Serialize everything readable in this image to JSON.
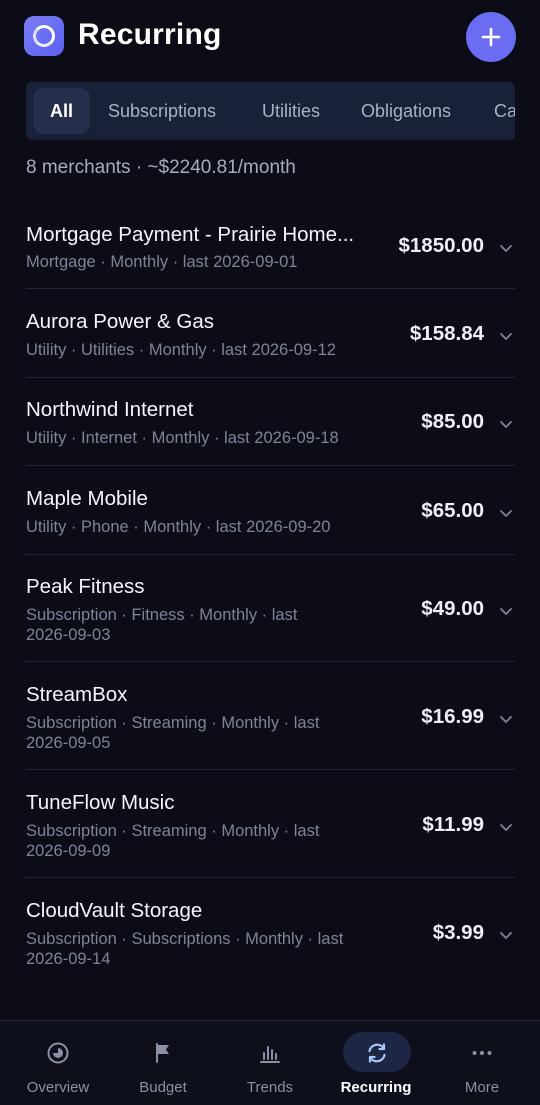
{
  "header": {
    "title": "Recurring",
    "logo_icon": "app-ring-logo-icon",
    "add_icon": "plus-icon"
  },
  "tabs": [
    {
      "label": "All",
      "active": true
    },
    {
      "label": "Subscriptions",
      "active": false
    },
    {
      "label": "Utilities",
      "active": false
    },
    {
      "label": "Obligations",
      "active": false
    },
    {
      "label": "Ca",
      "active": false
    }
  ],
  "summary": "8 merchants · ~$2240.81/month",
  "merchants": [
    {
      "name": "Mortgage Payment - Prairie Home...",
      "meta": "Mortgage · Monthly · last 2026-09-01",
      "amount": "$1850.00"
    },
    {
      "name": "Aurora Power & Gas",
      "meta": "Utility · Utilities · Monthly · last 2026-09-12",
      "amount": "$158.84"
    },
    {
      "name": "Northwind Internet",
      "meta": "Utility · Internet · Monthly · last 2026-09-18",
      "amount": "$85.00"
    },
    {
      "name": "Maple Mobile",
      "meta": "Utility · Phone · Monthly · last 2026-09-20",
      "amount": "$65.00"
    },
    {
      "name": "Peak Fitness",
      "meta": "Subscription · Fitness · Monthly · last 2026-09-03",
      "amount": "$49.00"
    },
    {
      "name": "StreamBox",
      "meta": "Subscription · Streaming · Monthly · last 2026-09-05",
      "amount": "$16.99"
    },
    {
      "name": "TuneFlow Music",
      "meta": "Subscription · Streaming · Monthly · last 2026-09-09",
      "amount": "$11.99"
    },
    {
      "name": "CloudVault Storage",
      "meta": "Subscription · Subscriptions · Monthly · last 2026-09-14",
      "amount": "$3.99"
    }
  ],
  "nav": [
    {
      "label": "Overview",
      "icon": "pie-chart-icon",
      "active": false
    },
    {
      "label": "Budget",
      "icon": "flag-icon",
      "active": false
    },
    {
      "label": "Trends",
      "icon": "bar-chart-icon",
      "active": false
    },
    {
      "label": "Recurring",
      "icon": "refresh-icon",
      "active": true
    },
    {
      "label": "More",
      "icon": "more-dots-icon",
      "active": false
    }
  ],
  "colors": {
    "background": "#0b0c16",
    "accent": "#6a6cf2",
    "tab_bar": "#192138",
    "active_tab": "#252f4c",
    "muted_text": "#7d8497"
  }
}
